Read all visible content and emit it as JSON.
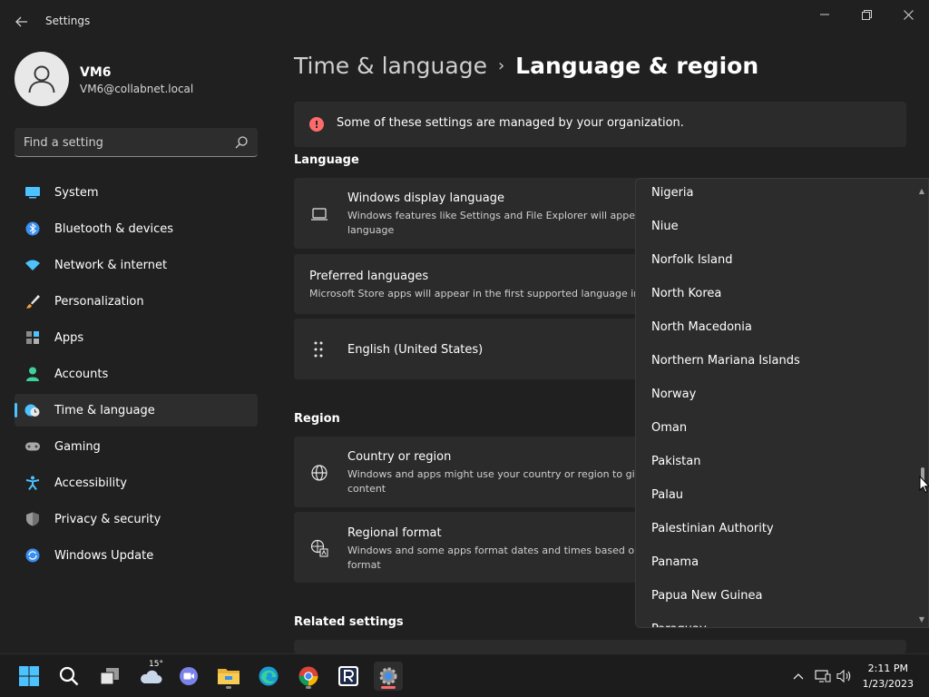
{
  "window": {
    "title": "Settings",
    "back_icon": "arrow-left-icon",
    "minimize_icon": "minimize-icon",
    "maximize_icon": "restore-icon",
    "close_icon": "close-icon"
  },
  "profile": {
    "name": "VM6",
    "email": "VM6@collabnet.local"
  },
  "search": {
    "placeholder": "Find a setting"
  },
  "sidebar": {
    "items": [
      {
        "label": "System",
        "icon": "monitor-icon"
      },
      {
        "label": "Bluetooth & devices",
        "icon": "bluetooth-icon"
      },
      {
        "label": "Network & internet",
        "icon": "wifi-icon"
      },
      {
        "label": "Personalization",
        "icon": "brush-icon"
      },
      {
        "label": "Apps",
        "icon": "apps-icon"
      },
      {
        "label": "Accounts",
        "icon": "person-icon"
      },
      {
        "label": "Time & language",
        "icon": "clock-globe-icon",
        "active": true
      },
      {
        "label": "Gaming",
        "icon": "gamepad-icon"
      },
      {
        "label": "Accessibility",
        "icon": "accessibility-icon"
      },
      {
        "label": "Privacy & security",
        "icon": "shield-icon"
      },
      {
        "label": "Windows Update",
        "icon": "update-icon"
      }
    ]
  },
  "breadcrumb": {
    "parent": "Time & language",
    "separator": "›",
    "current": "Language & region"
  },
  "notice": {
    "text": "Some of these settings are managed by your organization."
  },
  "language_section": {
    "title": "Language",
    "display_language": {
      "title": "Windows display language",
      "desc_line1": "Windows features like Settings and File Explorer will appea",
      "desc_line2": "language"
    },
    "preferred_languages": {
      "title": "Preferred languages",
      "desc": "Microsoft Store apps will appear in the first supported language in"
    },
    "english_item": {
      "label": "English (United States)"
    }
  },
  "region_section": {
    "title": "Region",
    "country": {
      "title": "Country or region",
      "desc_line1": "Windows and apps might use your country or region to giv",
      "desc_line2": "content"
    },
    "regional_format": {
      "title": "Regional format",
      "desc_line1": "Windows and some apps format dates and times based on",
      "desc_line2": "format"
    }
  },
  "related_settings": {
    "title": "Related settings"
  },
  "dropdown": {
    "items": [
      "Nigeria",
      "Niue",
      "Norfolk Island",
      "North Korea",
      "North Macedonia",
      "Northern Mariana Islands",
      "Norway",
      "Oman",
      "Pakistan",
      "Palau",
      "Palestinian Authority",
      "Panama",
      "Papua New Guinea",
      "Paraguay"
    ],
    "scroll_position": 0.66
  },
  "taskbar": {
    "weather_temp": "15°",
    "clock_time": "2:11 PM",
    "clock_date": "1/23/2023"
  },
  "colors": {
    "accent": "#4cc2ff",
    "background": "#202020",
    "card": "#2b2b2b",
    "warning": "#ff6b6b"
  }
}
